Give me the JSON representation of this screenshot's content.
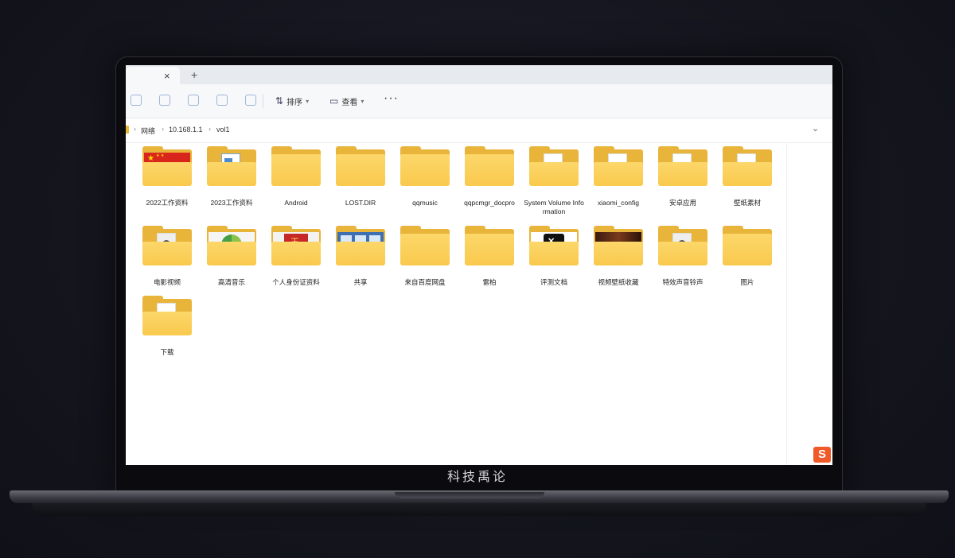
{
  "toolbar": {
    "sort_label": "排序",
    "view_label": "查看",
    "more_label": "···"
  },
  "tabs": {
    "close": "×",
    "new": "+"
  },
  "breadcrumb": [
    "网络",
    "10.168.1.1",
    "vol1"
  ],
  "watermark": "科技禹论",
  "folders_row1": [
    {
      "name": "2022工作资料",
      "thumb": "flag-cn"
    },
    {
      "name": "2023工作资料",
      "thumb": "doc-blue"
    },
    {
      "name": "Android",
      "thumb": "plain"
    },
    {
      "name": "LOST.DIR",
      "thumb": "plain"
    },
    {
      "name": "qqmusic",
      "thumb": "plain"
    },
    {
      "name": "qqpcmgr_docpro",
      "thumb": "plain"
    },
    {
      "name": "System Volume Information",
      "thumb": "paper"
    },
    {
      "name": "xiaomi_config",
      "thumb": "paper"
    },
    {
      "name": "安卓应用",
      "thumb": "paper"
    },
    {
      "name": "壁纸素材",
      "thumb": "paper"
    }
  ],
  "folders_row2": [
    {
      "name": "电影视频",
      "thumb": "photo"
    },
    {
      "name": "高清音乐",
      "thumb": "music"
    },
    {
      "name": "个人身份证资料",
      "thumb": "red-card"
    },
    {
      "name": "共享",
      "thumb": "screens"
    },
    {
      "name": "来自百度网盘",
      "thumb": "plain"
    },
    {
      "name": "雷柏",
      "thumb": "plain"
    },
    {
      "name": "评测文档",
      "thumb": "capcut"
    },
    {
      "name": "视频壁纸收藏",
      "thumb": "dark-photo"
    },
    {
      "name": "特效声音铃声",
      "thumb": "photo"
    },
    {
      "name": "图片",
      "thumb": "plain"
    }
  ],
  "folders_row3": [
    {
      "name": "下载",
      "thumb": "paper"
    }
  ],
  "accent_colors": {
    "folder_back": "#e9b43a",
    "folder_front": "#f9c94d",
    "logo": "#ef5a28"
  },
  "corner_logo": "S"
}
